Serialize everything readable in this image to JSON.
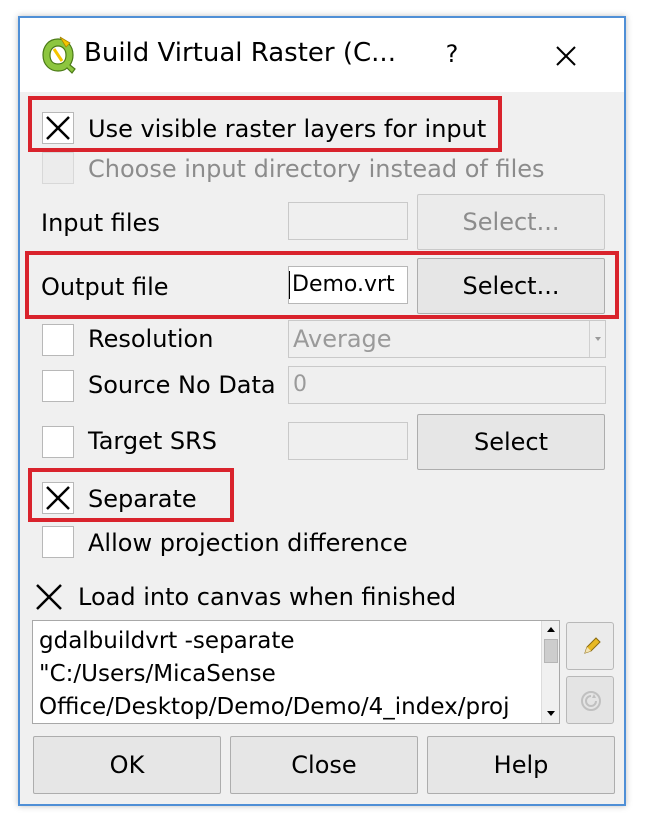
{
  "window": {
    "title": "Build Virtual Raster (C...",
    "help_label": "?"
  },
  "options": {
    "use_visible_layers": {
      "label": "Use visible raster layers for input",
      "checked": true
    },
    "choose_directory": {
      "label": "Choose input directory instead of files",
      "checked": false,
      "enabled": false
    }
  },
  "input_files": {
    "label": "Input files",
    "value": "",
    "select_label": "Select..."
  },
  "output_file": {
    "label": "Output file",
    "value": "Demo.vrt",
    "select_label": "Select..."
  },
  "resolution": {
    "label": "Resolution",
    "checked": false,
    "selected": "Average"
  },
  "source_nodata": {
    "label": "Source No Data",
    "checked": false,
    "value": "0"
  },
  "target_srs": {
    "label": "Target SRS",
    "checked": false,
    "value": "",
    "select_label": "Select"
  },
  "separate": {
    "label": "Separate",
    "checked": true
  },
  "allow_projection": {
    "label": "Allow projection difference",
    "checked": false
  },
  "load_canvas": {
    "label": "Load into canvas when finished",
    "checked": true
  },
  "command": {
    "line1": "gdalbuildvrt -separate",
    "line2": "\"C:/Users/MicaSense",
    "line3": "Office/Desktop/Demo/Demo/4_index/proj"
  },
  "footer": {
    "ok_label": "OK",
    "close_label": "Close",
    "help_label": "Help"
  },
  "colors": {
    "highlight": "#d9232c",
    "window_border": "#4f8fd6"
  }
}
